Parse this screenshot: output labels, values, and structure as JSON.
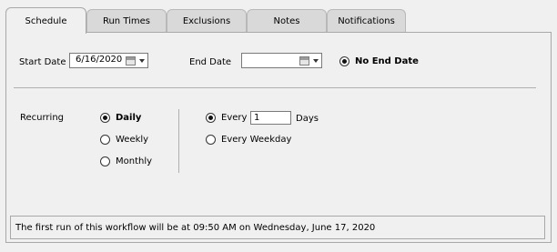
{
  "tabs": [
    "Schedule",
    "Run Times",
    "Exclusions",
    "Notes",
    "Notifications"
  ],
  "start_date": {
    "label": "Start Date",
    "value": "6/16/2020"
  },
  "end_date": {
    "label": "End Date",
    "value": ""
  },
  "no_end_date": {
    "label": "No End Date",
    "selected": true
  },
  "recurring": {
    "label": "Recurring",
    "options": [
      "Daily",
      "Weekly",
      "Monthly"
    ],
    "selected": "Daily"
  },
  "daily": {
    "every_label": "Every",
    "every_value": "1",
    "days_label": "Days",
    "every_weekday_label": "Every Weekday",
    "selected": "Every"
  },
  "status_text": "The first run of this workflow will be at 09:50 AM on Wednesday, June 17, 2020",
  "icons": {
    "date_picker": "calendar-icon",
    "dropdown": "chevron-down-icon"
  }
}
